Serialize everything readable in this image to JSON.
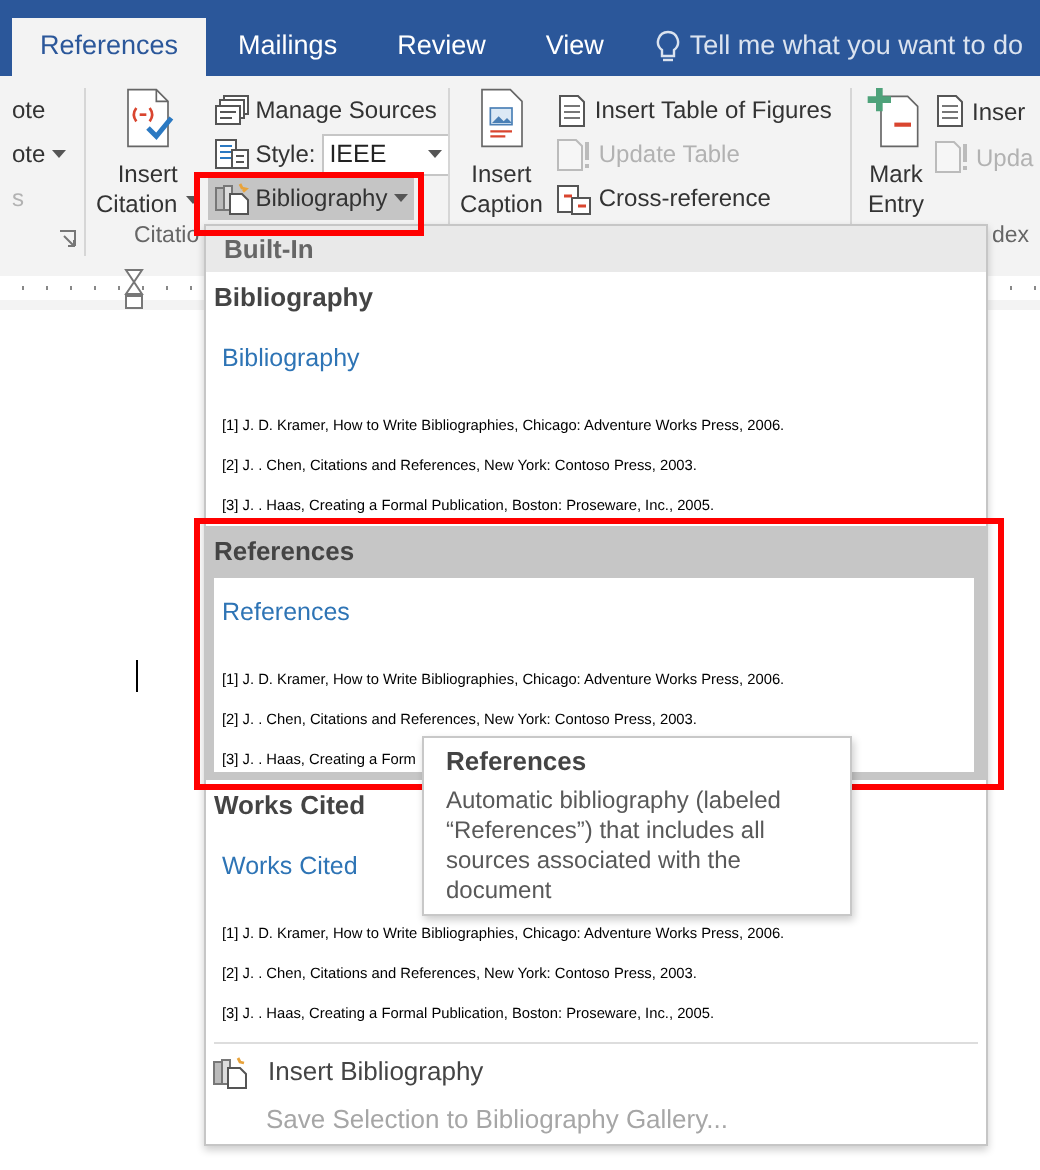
{
  "tabs": [
    {
      "label": "References",
      "selected": true
    },
    {
      "label": "Mailings",
      "selected": false
    },
    {
      "label": "Review",
      "selected": false
    },
    {
      "label": "View",
      "selected": false
    }
  ],
  "tell_me": {
    "placeholder": "Tell me what you want to do"
  },
  "ribbon": {
    "groups": [
      {
        "small_buttons": [
          {
            "kind": "button",
            "label": "ote",
            "disabled": false
          },
          {
            "kind": "button",
            "label": "ote",
            "menu": true,
            "disabled": false
          },
          {
            "kind": "button",
            "label": "s",
            "disabled": true
          }
        ],
        "dialog_launcher": true
      },
      {
        "large_button": {
          "lines": [
            "Insert",
            "Citation"
          ],
          "menu": true
        },
        "small_buttons": [
          {
            "kind": "button",
            "label": "Manage Sources",
            "disabled": false
          },
          {
            "kind": "dropdown",
            "label": "Style:",
            "value": "IEEE"
          },
          {
            "kind": "button",
            "label": "Bibliography",
            "menu": true,
            "disabled": false,
            "pressed": true,
            "highlighted": true
          }
        ],
        "label": "Citatio"
      },
      {
        "large_button": {
          "lines": [
            "Insert",
            "Caption"
          ]
        },
        "small_buttons": [
          {
            "kind": "button",
            "label": "Insert Table of Figures",
            "disabled": false
          },
          {
            "kind": "button",
            "label": "Update Table",
            "disabled": true
          },
          {
            "kind": "button",
            "label": "Cross-reference",
            "disabled": false
          }
        ]
      },
      {
        "large_button": {
          "lines": [
            "Mark",
            "Entry"
          ]
        },
        "small_buttons": [
          {
            "kind": "button",
            "label": "Inser",
            "disabled": false
          },
          {
            "kind": "button",
            "label": "Upda",
            "disabled": true
          }
        ],
        "label": "dex"
      }
    ]
  },
  "bibliography_menu": {
    "section": "Built-In",
    "items": [
      {
        "title": "Bibliography",
        "heading": "Bibliography",
        "entries": [
          "[1] J. D. Kramer, How to Write Bibliographies, Chicago: Adventure Works Press, 2006.",
          "[2] J. . Chen, Citations and References, New York: Contoso Press, 2003.",
          "[3] J. . Haas, Creating a Formal Publication, Boston: Proseware, Inc., 2005."
        ],
        "hovered": false
      },
      {
        "title": "References",
        "heading": "References",
        "entries": [
          "[1] J. D. Kramer, How to Write Bibliographies, Chicago: Adventure Works Press, 2006.",
          "[2] J. . Chen, Citations and References, New York: Contoso Press, 2003.",
          "[3] J. . Haas, Creating a Form"
        ],
        "hovered": true,
        "highlighted": true
      },
      {
        "title": "Works Cited",
        "heading": "Works Cited",
        "entries": [
          "[1] J. D. Kramer, How to Write Bibliographies, Chicago: Adventure Works Press, 2006.",
          "[2] J. . Chen, Citations and References, New York: Contoso Press, 2003.",
          "[3] J. . Haas, Creating a Formal Publication, Boston: Proseware, Inc., 2005."
        ],
        "hovered": false
      }
    ],
    "commands": [
      {
        "label": "Insert Bibliography",
        "disabled": false
      },
      {
        "label": "Save Selection to Bibliography Gallery...",
        "disabled": true
      }
    ]
  },
  "tooltip": {
    "title": "References",
    "text": "Automatic bibliography (labeled “References”) that includes all sources associated with the document"
  }
}
